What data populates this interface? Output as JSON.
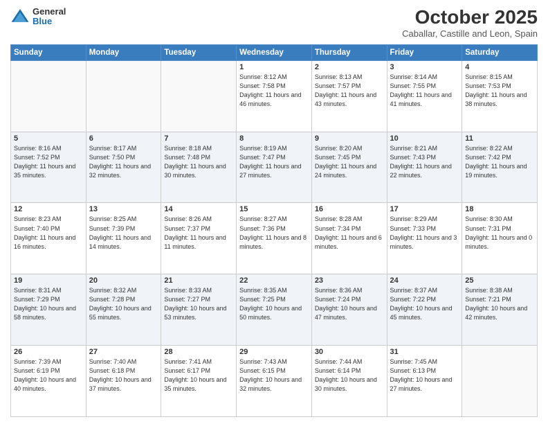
{
  "header": {
    "logo_general": "General",
    "logo_blue": "Blue",
    "title": "October 2025",
    "subtitle": "Caballar, Castille and Leon, Spain"
  },
  "days_of_week": [
    "Sunday",
    "Monday",
    "Tuesday",
    "Wednesday",
    "Thursday",
    "Friday",
    "Saturday"
  ],
  "weeks": [
    [
      {
        "day": "",
        "info": ""
      },
      {
        "day": "",
        "info": ""
      },
      {
        "day": "",
        "info": ""
      },
      {
        "day": "1",
        "info": "Sunrise: 8:12 AM\nSunset: 7:58 PM\nDaylight: 11 hours and 46 minutes."
      },
      {
        "day": "2",
        "info": "Sunrise: 8:13 AM\nSunset: 7:57 PM\nDaylight: 11 hours and 43 minutes."
      },
      {
        "day": "3",
        "info": "Sunrise: 8:14 AM\nSunset: 7:55 PM\nDaylight: 11 hours and 41 minutes."
      },
      {
        "day": "4",
        "info": "Sunrise: 8:15 AM\nSunset: 7:53 PM\nDaylight: 11 hours and 38 minutes."
      }
    ],
    [
      {
        "day": "5",
        "info": "Sunrise: 8:16 AM\nSunset: 7:52 PM\nDaylight: 11 hours and 35 minutes."
      },
      {
        "day": "6",
        "info": "Sunrise: 8:17 AM\nSunset: 7:50 PM\nDaylight: 11 hours and 32 minutes."
      },
      {
        "day": "7",
        "info": "Sunrise: 8:18 AM\nSunset: 7:48 PM\nDaylight: 11 hours and 30 minutes."
      },
      {
        "day": "8",
        "info": "Sunrise: 8:19 AM\nSunset: 7:47 PM\nDaylight: 11 hours and 27 minutes."
      },
      {
        "day": "9",
        "info": "Sunrise: 8:20 AM\nSunset: 7:45 PM\nDaylight: 11 hours and 24 minutes."
      },
      {
        "day": "10",
        "info": "Sunrise: 8:21 AM\nSunset: 7:43 PM\nDaylight: 11 hours and 22 minutes."
      },
      {
        "day": "11",
        "info": "Sunrise: 8:22 AM\nSunset: 7:42 PM\nDaylight: 11 hours and 19 minutes."
      }
    ],
    [
      {
        "day": "12",
        "info": "Sunrise: 8:23 AM\nSunset: 7:40 PM\nDaylight: 11 hours and 16 minutes."
      },
      {
        "day": "13",
        "info": "Sunrise: 8:25 AM\nSunset: 7:39 PM\nDaylight: 11 hours and 14 minutes."
      },
      {
        "day": "14",
        "info": "Sunrise: 8:26 AM\nSunset: 7:37 PM\nDaylight: 11 hours and 11 minutes."
      },
      {
        "day": "15",
        "info": "Sunrise: 8:27 AM\nSunset: 7:36 PM\nDaylight: 11 hours and 8 minutes."
      },
      {
        "day": "16",
        "info": "Sunrise: 8:28 AM\nSunset: 7:34 PM\nDaylight: 11 hours and 6 minutes."
      },
      {
        "day": "17",
        "info": "Sunrise: 8:29 AM\nSunset: 7:33 PM\nDaylight: 11 hours and 3 minutes."
      },
      {
        "day": "18",
        "info": "Sunrise: 8:30 AM\nSunset: 7:31 PM\nDaylight: 11 hours and 0 minutes."
      }
    ],
    [
      {
        "day": "19",
        "info": "Sunrise: 8:31 AM\nSunset: 7:29 PM\nDaylight: 10 hours and 58 minutes."
      },
      {
        "day": "20",
        "info": "Sunrise: 8:32 AM\nSunset: 7:28 PM\nDaylight: 10 hours and 55 minutes."
      },
      {
        "day": "21",
        "info": "Sunrise: 8:33 AM\nSunset: 7:27 PM\nDaylight: 10 hours and 53 minutes."
      },
      {
        "day": "22",
        "info": "Sunrise: 8:35 AM\nSunset: 7:25 PM\nDaylight: 10 hours and 50 minutes."
      },
      {
        "day": "23",
        "info": "Sunrise: 8:36 AM\nSunset: 7:24 PM\nDaylight: 10 hours and 47 minutes."
      },
      {
        "day": "24",
        "info": "Sunrise: 8:37 AM\nSunset: 7:22 PM\nDaylight: 10 hours and 45 minutes."
      },
      {
        "day": "25",
        "info": "Sunrise: 8:38 AM\nSunset: 7:21 PM\nDaylight: 10 hours and 42 minutes."
      }
    ],
    [
      {
        "day": "26",
        "info": "Sunrise: 7:39 AM\nSunset: 6:19 PM\nDaylight: 10 hours and 40 minutes."
      },
      {
        "day": "27",
        "info": "Sunrise: 7:40 AM\nSunset: 6:18 PM\nDaylight: 10 hours and 37 minutes."
      },
      {
        "day": "28",
        "info": "Sunrise: 7:41 AM\nSunset: 6:17 PM\nDaylight: 10 hours and 35 minutes."
      },
      {
        "day": "29",
        "info": "Sunrise: 7:43 AM\nSunset: 6:15 PM\nDaylight: 10 hours and 32 minutes."
      },
      {
        "day": "30",
        "info": "Sunrise: 7:44 AM\nSunset: 6:14 PM\nDaylight: 10 hours and 30 minutes."
      },
      {
        "day": "31",
        "info": "Sunrise: 7:45 AM\nSunset: 6:13 PM\nDaylight: 10 hours and 27 minutes."
      },
      {
        "day": "",
        "info": ""
      }
    ]
  ]
}
